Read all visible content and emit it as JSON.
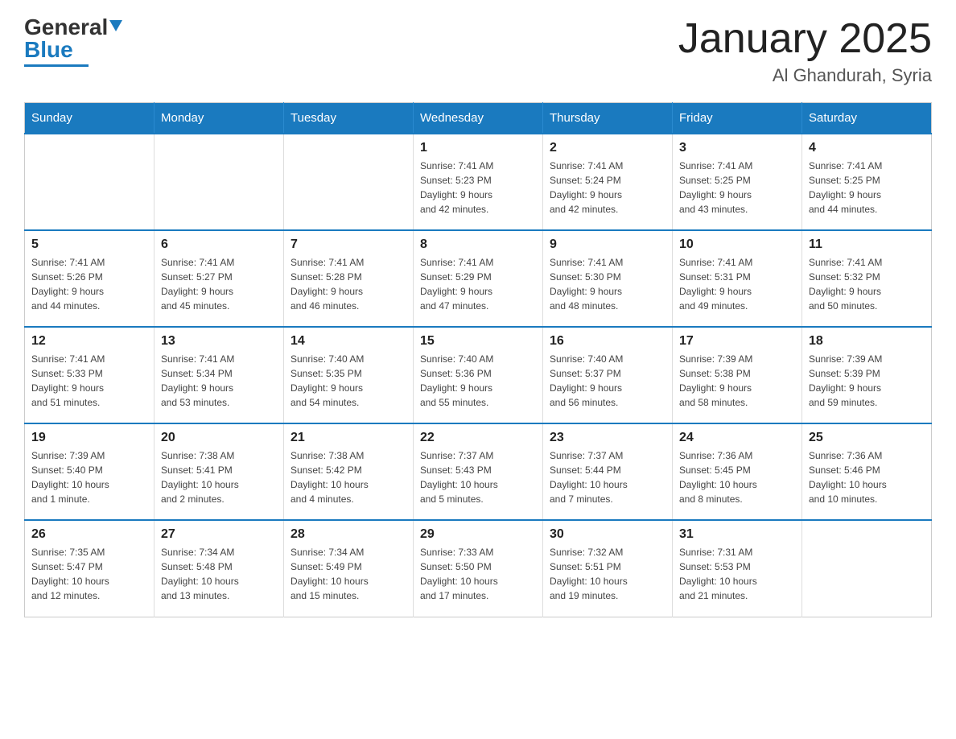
{
  "header": {
    "logo_general": "General",
    "logo_blue": "Blue",
    "title": "January 2025",
    "subtitle": "Al Ghandurah, Syria"
  },
  "calendar": {
    "days_of_week": [
      "Sunday",
      "Monday",
      "Tuesday",
      "Wednesday",
      "Thursday",
      "Friday",
      "Saturday"
    ],
    "weeks": [
      [
        {
          "day": "",
          "info": ""
        },
        {
          "day": "",
          "info": ""
        },
        {
          "day": "",
          "info": ""
        },
        {
          "day": "1",
          "info": "Sunrise: 7:41 AM\nSunset: 5:23 PM\nDaylight: 9 hours\nand 42 minutes."
        },
        {
          "day": "2",
          "info": "Sunrise: 7:41 AM\nSunset: 5:24 PM\nDaylight: 9 hours\nand 42 minutes."
        },
        {
          "day": "3",
          "info": "Sunrise: 7:41 AM\nSunset: 5:25 PM\nDaylight: 9 hours\nand 43 minutes."
        },
        {
          "day": "4",
          "info": "Sunrise: 7:41 AM\nSunset: 5:25 PM\nDaylight: 9 hours\nand 44 minutes."
        }
      ],
      [
        {
          "day": "5",
          "info": "Sunrise: 7:41 AM\nSunset: 5:26 PM\nDaylight: 9 hours\nand 44 minutes."
        },
        {
          "day": "6",
          "info": "Sunrise: 7:41 AM\nSunset: 5:27 PM\nDaylight: 9 hours\nand 45 minutes."
        },
        {
          "day": "7",
          "info": "Sunrise: 7:41 AM\nSunset: 5:28 PM\nDaylight: 9 hours\nand 46 minutes."
        },
        {
          "day": "8",
          "info": "Sunrise: 7:41 AM\nSunset: 5:29 PM\nDaylight: 9 hours\nand 47 minutes."
        },
        {
          "day": "9",
          "info": "Sunrise: 7:41 AM\nSunset: 5:30 PM\nDaylight: 9 hours\nand 48 minutes."
        },
        {
          "day": "10",
          "info": "Sunrise: 7:41 AM\nSunset: 5:31 PM\nDaylight: 9 hours\nand 49 minutes."
        },
        {
          "day": "11",
          "info": "Sunrise: 7:41 AM\nSunset: 5:32 PM\nDaylight: 9 hours\nand 50 minutes."
        }
      ],
      [
        {
          "day": "12",
          "info": "Sunrise: 7:41 AM\nSunset: 5:33 PM\nDaylight: 9 hours\nand 51 minutes."
        },
        {
          "day": "13",
          "info": "Sunrise: 7:41 AM\nSunset: 5:34 PM\nDaylight: 9 hours\nand 53 minutes."
        },
        {
          "day": "14",
          "info": "Sunrise: 7:40 AM\nSunset: 5:35 PM\nDaylight: 9 hours\nand 54 minutes."
        },
        {
          "day": "15",
          "info": "Sunrise: 7:40 AM\nSunset: 5:36 PM\nDaylight: 9 hours\nand 55 minutes."
        },
        {
          "day": "16",
          "info": "Sunrise: 7:40 AM\nSunset: 5:37 PM\nDaylight: 9 hours\nand 56 minutes."
        },
        {
          "day": "17",
          "info": "Sunrise: 7:39 AM\nSunset: 5:38 PM\nDaylight: 9 hours\nand 58 minutes."
        },
        {
          "day": "18",
          "info": "Sunrise: 7:39 AM\nSunset: 5:39 PM\nDaylight: 9 hours\nand 59 minutes."
        }
      ],
      [
        {
          "day": "19",
          "info": "Sunrise: 7:39 AM\nSunset: 5:40 PM\nDaylight: 10 hours\nand 1 minute."
        },
        {
          "day": "20",
          "info": "Sunrise: 7:38 AM\nSunset: 5:41 PM\nDaylight: 10 hours\nand 2 minutes."
        },
        {
          "day": "21",
          "info": "Sunrise: 7:38 AM\nSunset: 5:42 PM\nDaylight: 10 hours\nand 4 minutes."
        },
        {
          "day": "22",
          "info": "Sunrise: 7:37 AM\nSunset: 5:43 PM\nDaylight: 10 hours\nand 5 minutes."
        },
        {
          "day": "23",
          "info": "Sunrise: 7:37 AM\nSunset: 5:44 PM\nDaylight: 10 hours\nand 7 minutes."
        },
        {
          "day": "24",
          "info": "Sunrise: 7:36 AM\nSunset: 5:45 PM\nDaylight: 10 hours\nand 8 minutes."
        },
        {
          "day": "25",
          "info": "Sunrise: 7:36 AM\nSunset: 5:46 PM\nDaylight: 10 hours\nand 10 minutes."
        }
      ],
      [
        {
          "day": "26",
          "info": "Sunrise: 7:35 AM\nSunset: 5:47 PM\nDaylight: 10 hours\nand 12 minutes."
        },
        {
          "day": "27",
          "info": "Sunrise: 7:34 AM\nSunset: 5:48 PM\nDaylight: 10 hours\nand 13 minutes."
        },
        {
          "day": "28",
          "info": "Sunrise: 7:34 AM\nSunset: 5:49 PM\nDaylight: 10 hours\nand 15 minutes."
        },
        {
          "day": "29",
          "info": "Sunrise: 7:33 AM\nSunset: 5:50 PM\nDaylight: 10 hours\nand 17 minutes."
        },
        {
          "day": "30",
          "info": "Sunrise: 7:32 AM\nSunset: 5:51 PM\nDaylight: 10 hours\nand 19 minutes."
        },
        {
          "day": "31",
          "info": "Sunrise: 7:31 AM\nSunset: 5:53 PM\nDaylight: 10 hours\nand 21 minutes."
        },
        {
          "day": "",
          "info": ""
        }
      ]
    ]
  }
}
